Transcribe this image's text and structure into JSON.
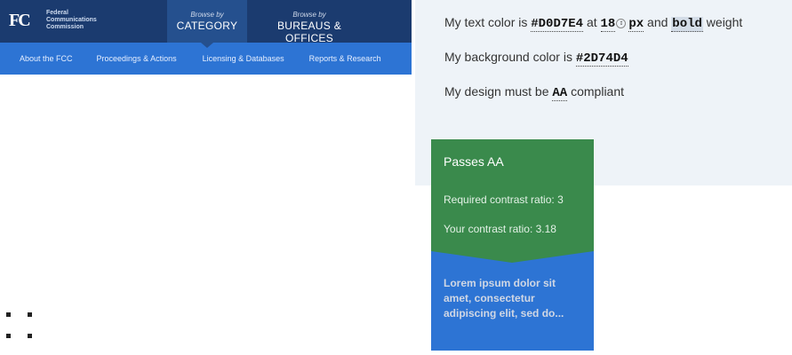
{
  "fcc": {
    "logo": "FC",
    "name_lines": [
      "Federal",
      "Communications",
      "Commission"
    ],
    "browse_category": {
      "small": "Browse by",
      "big": "CATEGORY"
    },
    "browse_bureaus": {
      "small": "Browse by",
      "big": "BUREAUS & OFFICES"
    },
    "nav": [
      "About the FCC",
      "Proceedings & Actions",
      "Licensing & Databases",
      "Reports & Research"
    ],
    "colors": {
      "header": "#1b3b6f",
      "nav": "#2d74d4"
    }
  },
  "panel": {
    "line1": {
      "pre": "My text color is ",
      "color": "#D0D7E4",
      "mid": " at ",
      "size": "18",
      "unit": "px",
      "and": " and ",
      "weight": "bold",
      "post": " weight"
    },
    "line2": {
      "pre": "My background color is ",
      "color": "#2D74D4"
    },
    "line3": {
      "pre": "My design must be ",
      "level": "AA",
      "post": " compliant"
    }
  },
  "result": {
    "title": "Passes AA",
    "required": "Required contrast ratio: 3",
    "yours": "Your contrast ratio: 3.18",
    "sample_text": "Lorem ipsum dolor sit amet, consectetur adipiscing elit, sed do...",
    "colors": {
      "pass": "#3a8a4c",
      "sample_bg": "#2D74D4",
      "sample_fg": "#D0D7E4"
    }
  },
  "icons": {
    "stepper": "number-stepper-icon",
    "grip": "drag-handle-icon"
  }
}
